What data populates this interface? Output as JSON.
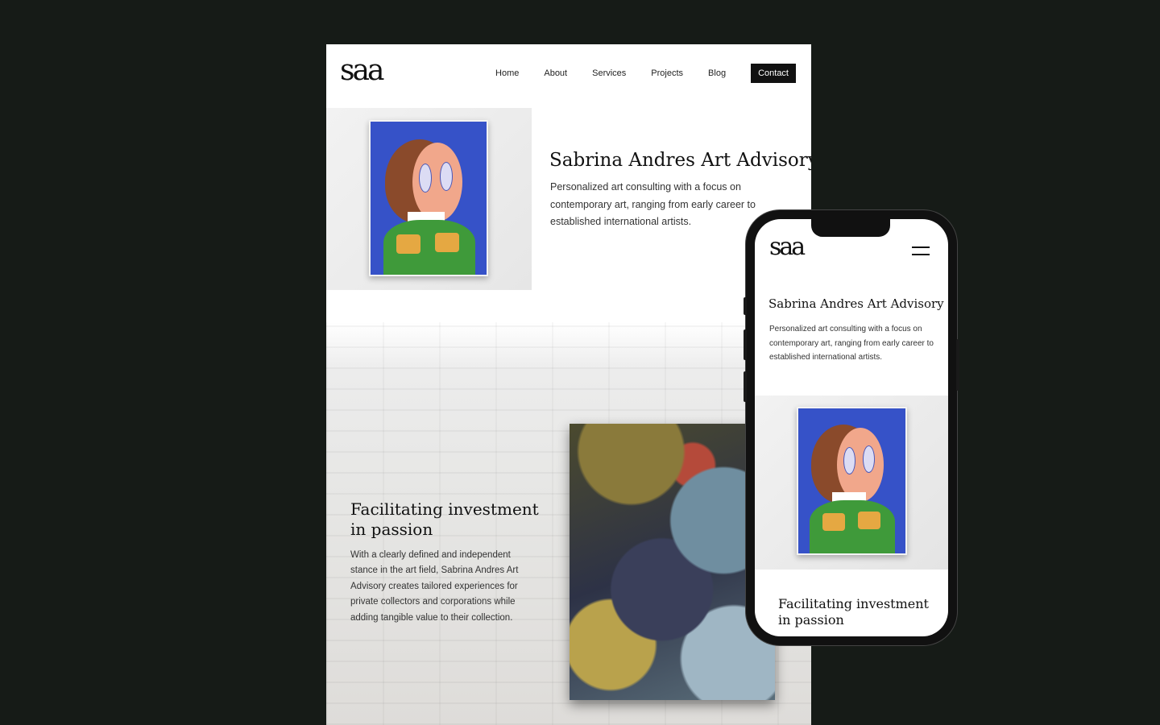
{
  "site": {
    "logo_text": "saa",
    "nav": {
      "home": "Home",
      "about": "About",
      "services": "Services",
      "projects": "Projects",
      "blog": "Blog",
      "contact": "Contact"
    },
    "hero": {
      "title": "Sabrina Andres Art Advisory",
      "description": "Personalized art consulting with a focus on contemporary art, ranging from early career to established international artists."
    },
    "section2": {
      "heading": "Facilitating investment in passion",
      "body": "With a clearly defined and independent stance in the art field, Sabrina Andres Art Advisory creates tailored experiences for private collectors and corporations while adding tangible value to their collection."
    }
  },
  "mobile": {
    "menu_icon": "hamburger-icon"
  },
  "colors": {
    "background": "#161b17",
    "contact_button": "#111111",
    "painting_blue": "#3652c8"
  }
}
